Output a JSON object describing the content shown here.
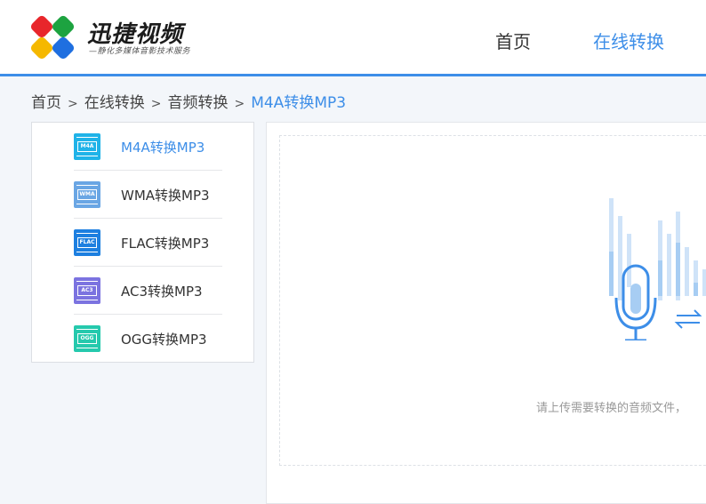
{
  "header": {
    "logo_title": "迅捷视频",
    "logo_slogan": "—静化多媒体音影技术服务",
    "nav": [
      {
        "label": "首页",
        "active": false
      },
      {
        "label": "在线转换",
        "active": true
      }
    ]
  },
  "breadcrumb": {
    "items": [
      "首页",
      "在线转换",
      "音频转换"
    ],
    "separator": ">",
    "current": "M4A转换MP3"
  },
  "sidebar": {
    "items": [
      {
        "label": "M4A转换MP3",
        "icon_text": "M4A",
        "icon": "m4a-file-icon",
        "color": "#1fb3e8",
        "active": true
      },
      {
        "label": "WMA转换MP3",
        "icon_text": "WMA",
        "icon": "wma-file-icon",
        "color": "#6aa6e4",
        "active": false
      },
      {
        "label": "FLAC转换MP3",
        "icon_text": "FLAC",
        "icon": "flac-file-icon",
        "color": "#1d7fe0",
        "active": false
      },
      {
        "label": "AC3转换MP3",
        "icon_text": "AC3",
        "icon": "ac3-file-icon",
        "color": "#7b73e0",
        "active": false
      },
      {
        "label": "OGG转换MP3",
        "icon_text": "OGG",
        "icon": "ogg-file-icon",
        "color": "#25c9ad",
        "active": false
      }
    ]
  },
  "upload": {
    "hint": "请上传需要转换的音频文件，"
  },
  "colors": {
    "accent": "#3d8ee8"
  }
}
